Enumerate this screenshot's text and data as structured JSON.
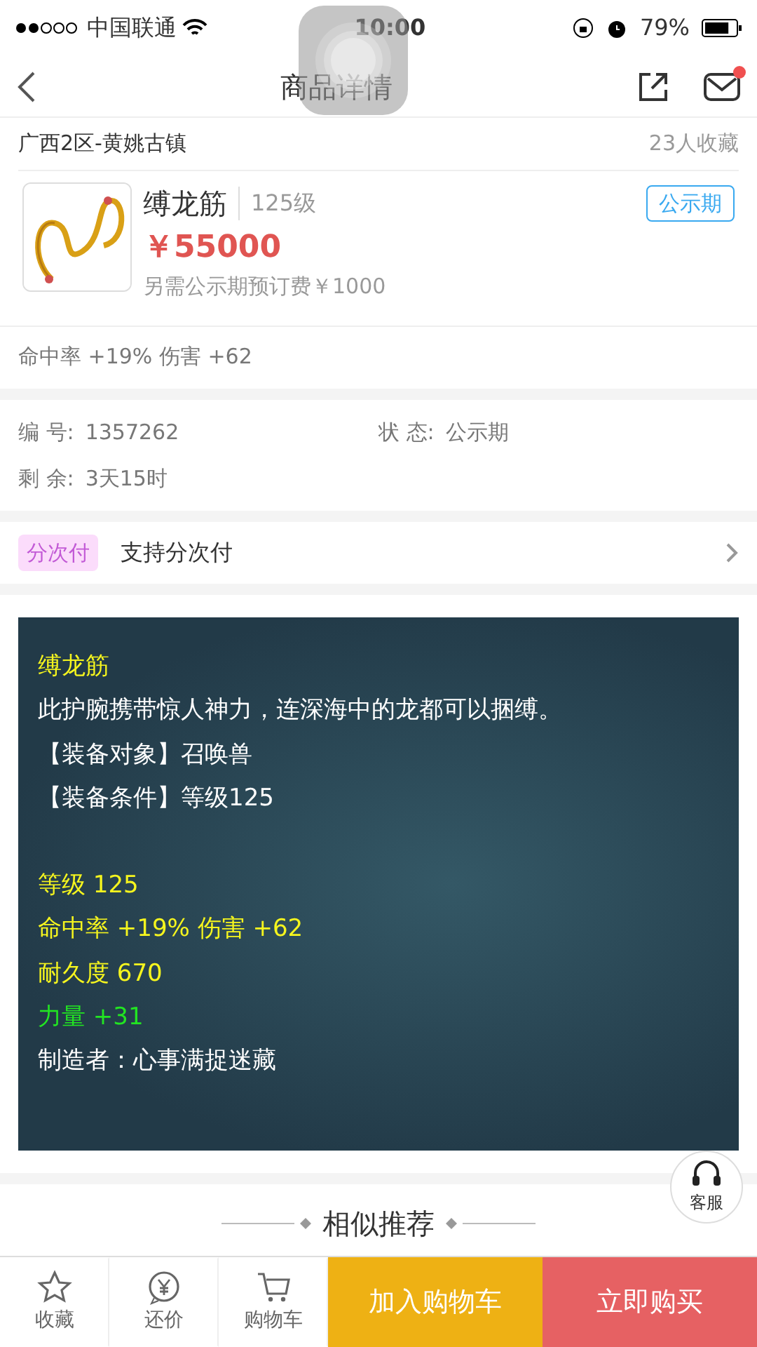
{
  "status_bar": {
    "carrier": "中国联通",
    "time": "10:00",
    "battery": "79%"
  },
  "nav": {
    "title": "商品详情",
    "has_notification": true
  },
  "server": {
    "name": "广西2区-黄姚古镇",
    "favorites": "23人收藏"
  },
  "item": {
    "name": "缚龙筋",
    "level": "125级",
    "price": "￥55000",
    "deposit": "另需公示期预订费￥1000",
    "status_tag": "公示期",
    "attributes": "命中率 +19% 伤害 +62"
  },
  "info": [
    {
      "label": "编 号:",
      "value": "1357262"
    },
    {
      "label": "状 态:",
      "value": "公示期"
    },
    {
      "label": "剩 余:",
      "value": "3天15时"
    }
  ],
  "installment": {
    "tag": "分次付",
    "text": "支持分次付"
  },
  "description": [
    {
      "kind": "title",
      "text": "缚龙筋"
    },
    {
      "kind": "text",
      "text": "此护腕携带惊人神力，连深海中的龙都可以捆缚。"
    },
    {
      "kind": "text",
      "text": "【装备对象】召唤兽"
    },
    {
      "kind": "text",
      "text": "【装备条件】等级125"
    },
    {
      "kind": "blank"
    },
    {
      "kind": "attr",
      "text": "等级 125"
    },
    {
      "kind": "attr",
      "text": "命中率 +19% 伤害 +62"
    },
    {
      "kind": "attr",
      "text": "耐久度 670"
    },
    {
      "kind": "bonus",
      "text": "力量 +31"
    },
    {
      "kind": "text",
      "text": "制造者：心事满捉迷藏"
    }
  ],
  "similar": {
    "title": "相似推荐"
  },
  "service": {
    "label": "客服"
  },
  "bottom_bar": {
    "tabs": [
      {
        "kind": "star",
        "label": "收藏"
      },
      {
        "kind": "yen",
        "label": "还价"
      },
      {
        "kind": "cart",
        "label": "购物车"
      }
    ],
    "add_to_cart": "加入购物车",
    "buy_now": "立即购买"
  }
}
